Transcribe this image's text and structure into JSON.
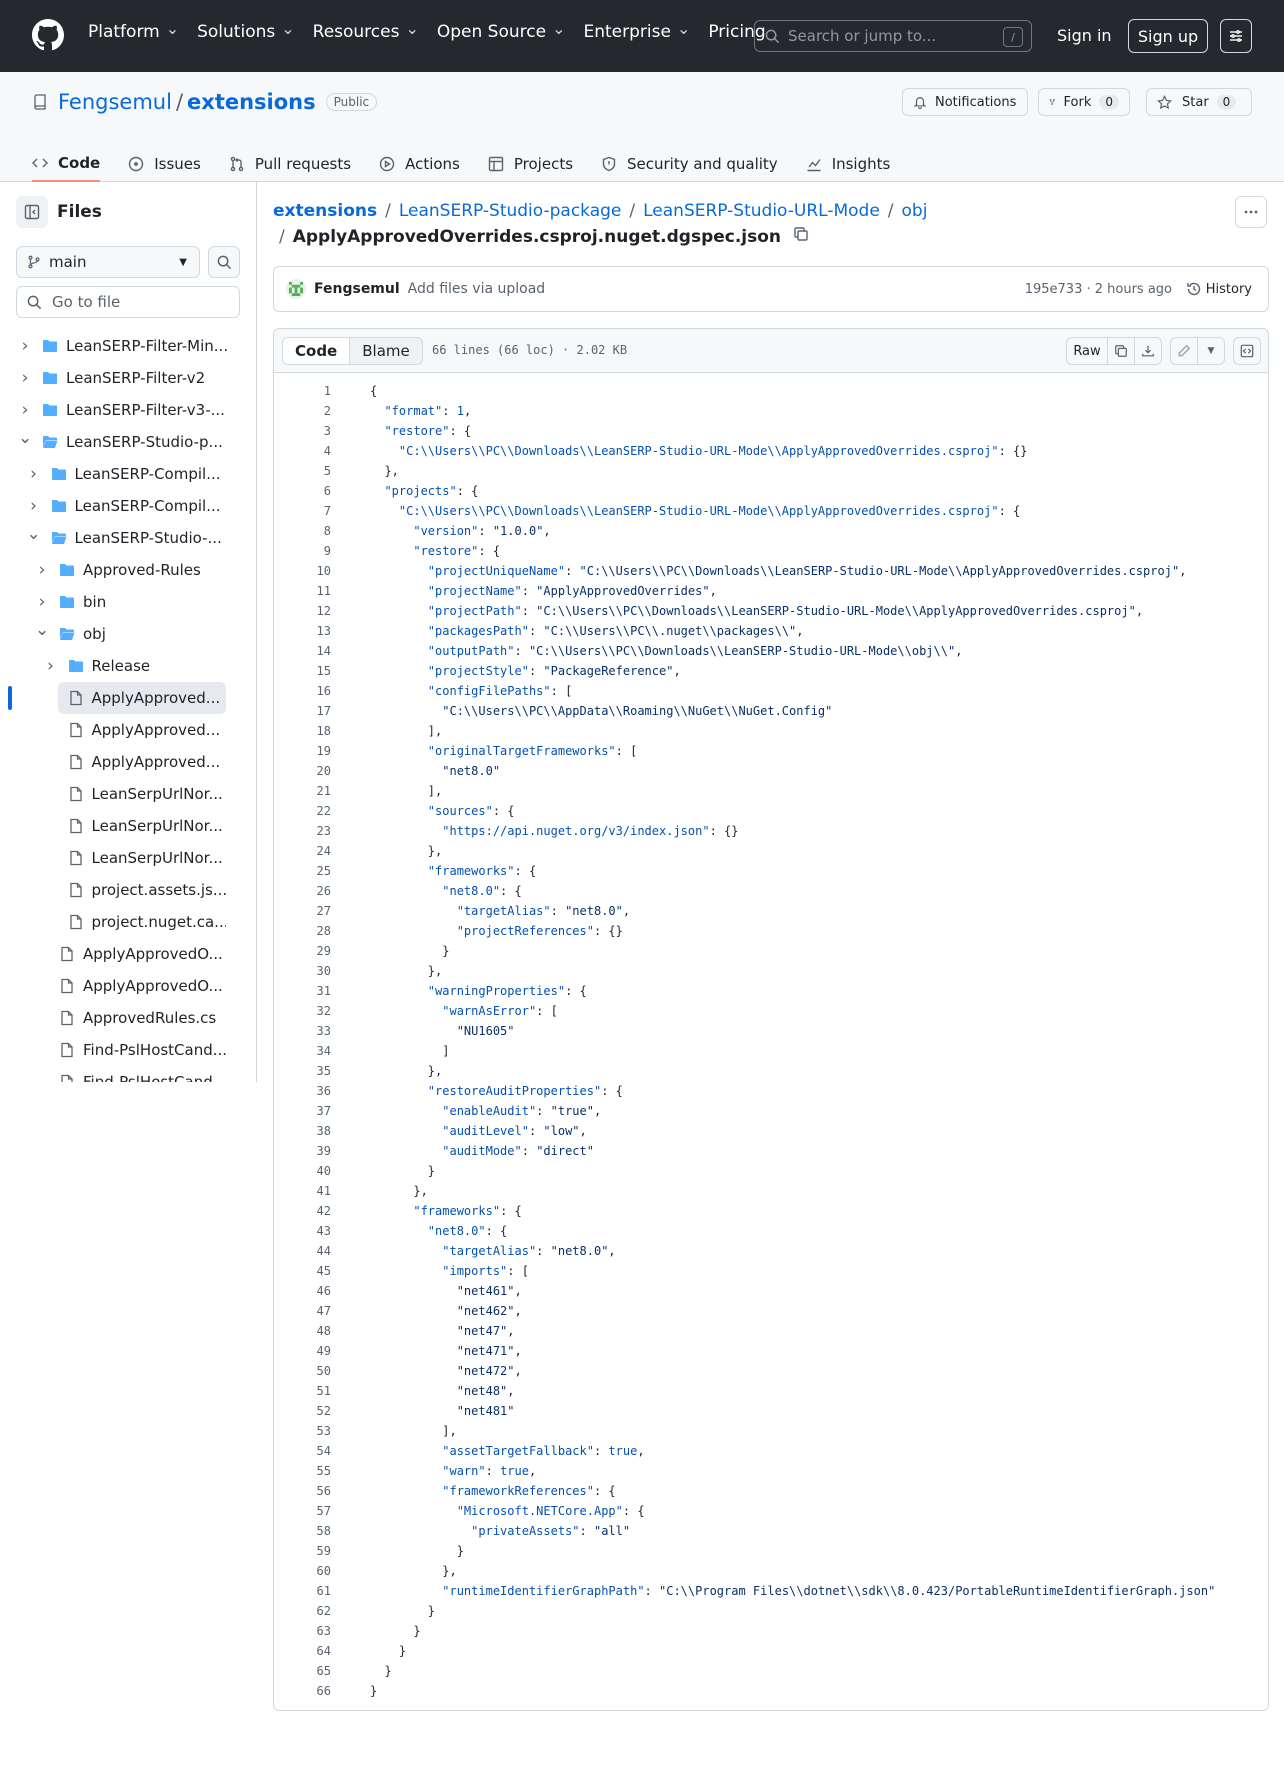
{
  "topbar": {
    "nav": [
      "Platform",
      "Solutions",
      "Resources",
      "Open Source",
      "Enterprise",
      "Pricing"
    ],
    "nav_has_chevron": [
      true,
      true,
      true,
      true,
      true,
      false
    ],
    "search_placeholder": "Search or jump to...",
    "search_shortcut": "/",
    "signin": "Sign in",
    "signup": "Sign up"
  },
  "repo": {
    "owner": "Fengsemul",
    "separator": "/",
    "name": "extensions",
    "visibility": "Public",
    "notifications": "Notifications",
    "fork_label": "Fork",
    "fork_count": "0",
    "star_label": "Star",
    "star_count": "0",
    "tabs": [
      "Code",
      "Issues",
      "Pull requests",
      "Actions",
      "Projects",
      "Security and quality",
      "Insights"
    ],
    "active_tab": "Code"
  },
  "sidebar": {
    "title": "Files",
    "branch": "main",
    "goto_placeholder": "Go to file",
    "tree": [
      {
        "label": "LeanSERP-Filter-Min...",
        "type": "folder",
        "depth": 0,
        "state": "closed"
      },
      {
        "label": "LeanSERP-Filter-v2",
        "type": "folder",
        "depth": 0,
        "state": "closed"
      },
      {
        "label": "LeanSERP-Filter-v3-...",
        "type": "folder",
        "depth": 0,
        "state": "closed"
      },
      {
        "label": "LeanSERP-Studio-p...",
        "type": "folder",
        "depth": 0,
        "state": "open"
      },
      {
        "label": "LeanSERP-Compil...",
        "type": "folder",
        "depth": 1,
        "state": "closed"
      },
      {
        "label": "LeanSERP-Compil...",
        "type": "folder",
        "depth": 1,
        "state": "closed"
      },
      {
        "label": "LeanSERP-Studio-...",
        "type": "folder",
        "depth": 1,
        "state": "open"
      },
      {
        "label": "Approved-Rules",
        "type": "folder",
        "depth": 2,
        "state": "closed"
      },
      {
        "label": "bin",
        "type": "folder",
        "depth": 2,
        "state": "closed"
      },
      {
        "label": "obj",
        "type": "folder",
        "depth": 2,
        "state": "open"
      },
      {
        "label": "Release",
        "type": "folder",
        "depth": 3,
        "state": "closed"
      },
      {
        "label": "ApplyApproved...",
        "type": "file",
        "depth": 3,
        "selected": true
      },
      {
        "label": "ApplyApproved...",
        "type": "file",
        "depth": 3
      },
      {
        "label": "ApplyApproved...",
        "type": "file",
        "depth": 3
      },
      {
        "label": "LeanSerpUrlNor...",
        "type": "file",
        "depth": 3
      },
      {
        "label": "LeanSerpUrlNor...",
        "type": "file",
        "depth": 3
      },
      {
        "label": "LeanSerpUrlNor...",
        "type": "file",
        "depth": 3
      },
      {
        "label": "project.assets.js...",
        "type": "file",
        "depth": 3
      },
      {
        "label": "project.nuget.ca...",
        "type": "file",
        "depth": 3
      },
      {
        "label": "ApplyApprovedO...",
        "type": "file",
        "depth": 2
      },
      {
        "label": "ApplyApprovedO...",
        "type": "file",
        "depth": 2
      },
      {
        "label": "ApprovedRules.cs",
        "type": "file",
        "depth": 2
      },
      {
        "label": "Find-PslHostCand...",
        "type": "file",
        "depth": 2
      },
      {
        "label": "Find-PslHostCand...",
        "type": "file",
        "depth": 2
      }
    ]
  },
  "breadcrumb": {
    "parts": [
      "extensions",
      "LeanSERP-Studio-package",
      "LeanSERP-Studio-URL-Mode",
      "obj"
    ],
    "separator": "/",
    "filename": "ApplyApprovedOverrides.csproj.nuget.dgspec.json"
  },
  "commit": {
    "author": "Fengsemul",
    "message": "Add files via upload",
    "meta": "195e733 · 2 hours ago",
    "history": "History"
  },
  "file": {
    "view_code": "Code",
    "view_blame": "Blame",
    "info": "66 lines (66 loc) · 2.02 KB",
    "raw": "Raw",
    "lines": [
      "{",
      "  \"format\": 1,",
      "  \"restore\": {",
      "    \"C:\\\\Users\\\\PC\\\\Downloads\\\\LeanSERP-Studio-URL-Mode\\\\ApplyApprovedOverrides.csproj\": {}",
      "  },",
      "  \"projects\": {",
      "    \"C:\\\\Users\\\\PC\\\\Downloads\\\\LeanSERP-Studio-URL-Mode\\\\ApplyApprovedOverrides.csproj\": {",
      "      \"version\": \"1.0.0\",",
      "      \"restore\": {",
      "        \"projectUniqueName\": \"C:\\\\Users\\\\PC\\\\Downloads\\\\LeanSERP-Studio-URL-Mode\\\\ApplyApprovedOverrides.csproj\",",
      "        \"projectName\": \"ApplyApprovedOverrides\",",
      "        \"projectPath\": \"C:\\\\Users\\\\PC\\\\Downloads\\\\LeanSERP-Studio-URL-Mode\\\\ApplyApprovedOverrides.csproj\",",
      "        \"packagesPath\": \"C:\\\\Users\\\\PC\\\\.nuget\\\\packages\\\\\",",
      "        \"outputPath\": \"C:\\\\Users\\\\PC\\\\Downloads\\\\LeanSERP-Studio-URL-Mode\\\\obj\\\\\",",
      "        \"projectStyle\": \"PackageReference\",",
      "        \"configFilePaths\": [",
      "          \"C:\\\\Users\\\\PC\\\\AppData\\\\Roaming\\\\NuGet\\\\NuGet.Config\"",
      "        ],",
      "        \"originalTargetFrameworks\": [",
      "          \"net8.0\"",
      "        ],",
      "        \"sources\": {",
      "          \"https://api.nuget.org/v3/index.json\": {}",
      "        },",
      "        \"frameworks\": {",
      "          \"net8.0\": {",
      "            \"targetAlias\": \"net8.0\",",
      "            \"projectReferences\": {}",
      "          }",
      "        },",
      "        \"warningProperties\": {",
      "          \"warnAsError\": [",
      "            \"NU1605\"",
      "          ]",
      "        },",
      "        \"restoreAuditProperties\": {",
      "          \"enableAudit\": \"true\",",
      "          \"auditLevel\": \"low\",",
      "          \"auditMode\": \"direct\"",
      "        }",
      "      },",
      "      \"frameworks\": {",
      "        \"net8.0\": {",
      "          \"targetAlias\": \"net8.0\",",
      "          \"imports\": [",
      "            \"net461\",",
      "            \"net462\",",
      "            \"net47\",",
      "            \"net471\",",
      "            \"net472\",",
      "            \"net48\",",
      "            \"net481\"",
      "          ],",
      "          \"assetTargetFallback\": true,",
      "          \"warn\": true,",
      "          \"frameworkReferences\": {",
      "            \"Microsoft.NETCore.App\": {",
      "              \"privateAssets\": \"all\"",
      "            }",
      "          },",
      "          \"runtimeIdentifierGraphPath\": \"C:\\\\Program Files\\\\dotnet\\\\sdk\\\\8.0.423/PortableRuntimeIdentifierGraph.json\"",
      "        }",
      "      }",
      "    }",
      "  }",
      "}"
    ]
  },
  "colors": {
    "header_bg": "#25292e",
    "link": "#0969da",
    "key": "#0550ae",
    "string": "#0a3069",
    "tab_underline": "#fd8c73",
    "folder": "#54aeff"
  }
}
